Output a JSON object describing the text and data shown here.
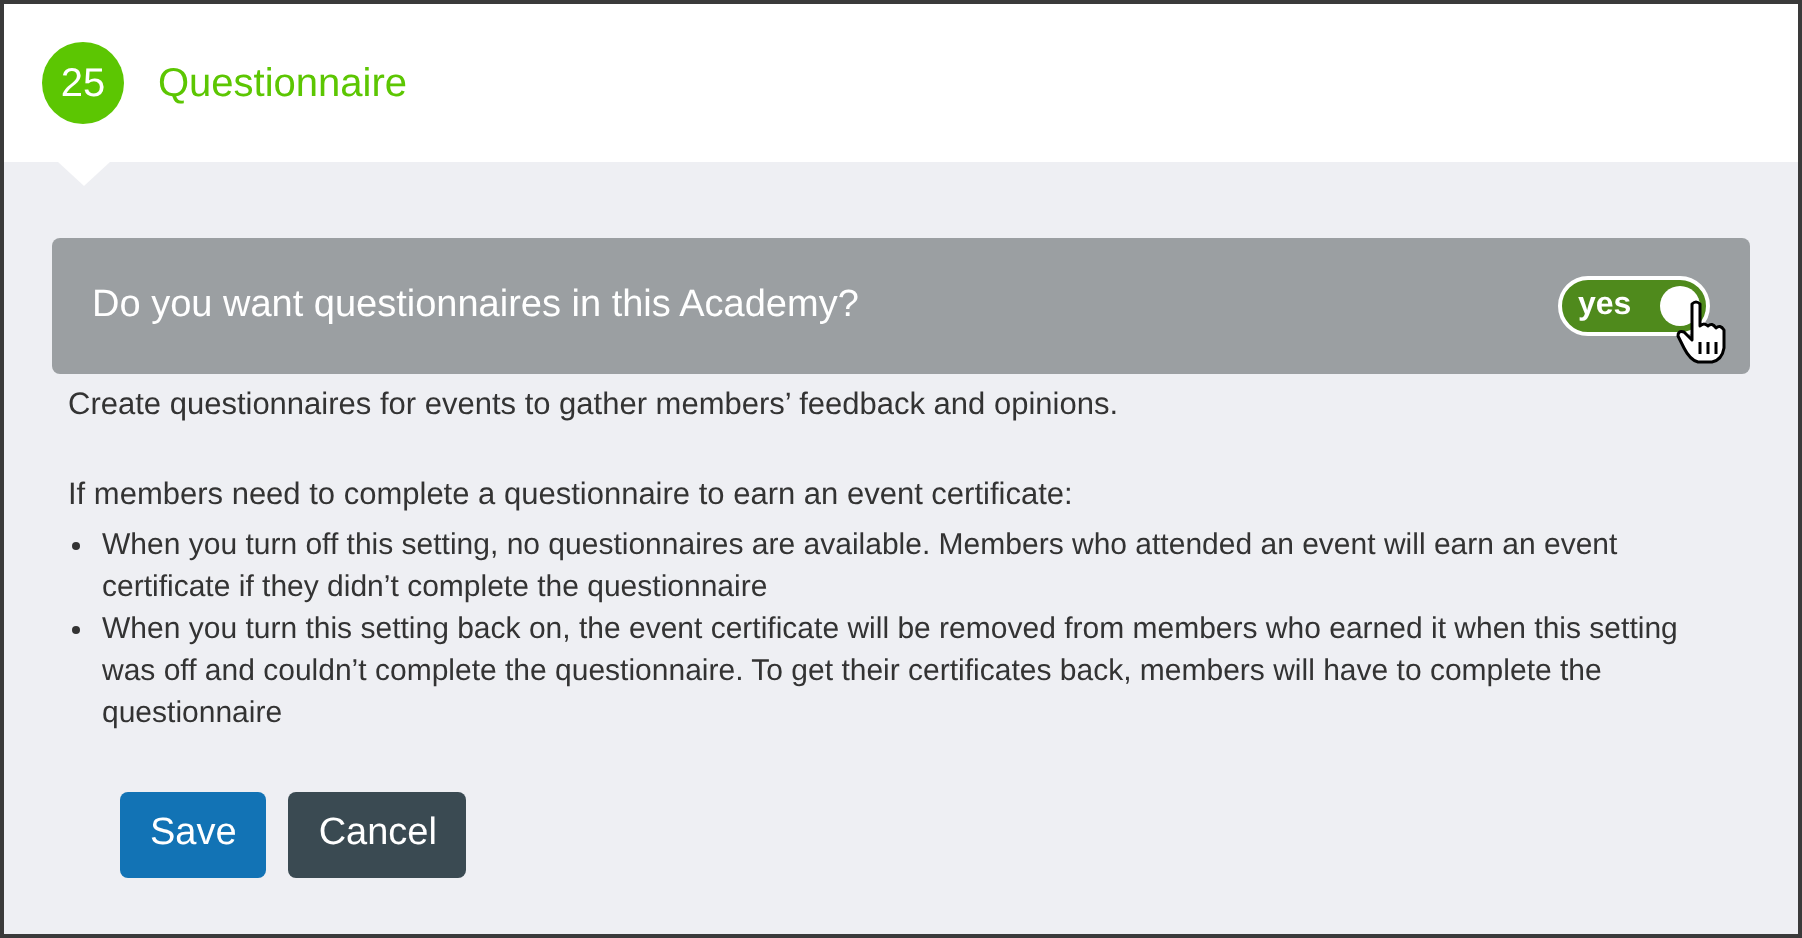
{
  "header": {
    "step": "25",
    "title": "Questionnaire"
  },
  "setting": {
    "question": "Do you want questionnaires in this Academy?",
    "toggle": {
      "label": "yes",
      "on": true
    }
  },
  "description": "Create questionnaires for events to gather members’ feedback and opinions.",
  "note": {
    "intro": "If members need to complete a questionnaire to earn an event certificate:",
    "bullets": [
      "When you turn off this setting, no questionnaires are available. Members who attended an event will earn an event certificate if they didn’t complete the questionnaire",
      "When you turn this setting back on, the event certificate will be removed from members who earned it when this setting was off and couldn’t complete the questionnaire. To get their certificates back, members will have to complete the questionnaire"
    ]
  },
  "buttons": [
    {
      "label": "Save",
      "kind": "primary"
    },
    {
      "label": "Cancel",
      "kind": "secondary"
    }
  ]
}
